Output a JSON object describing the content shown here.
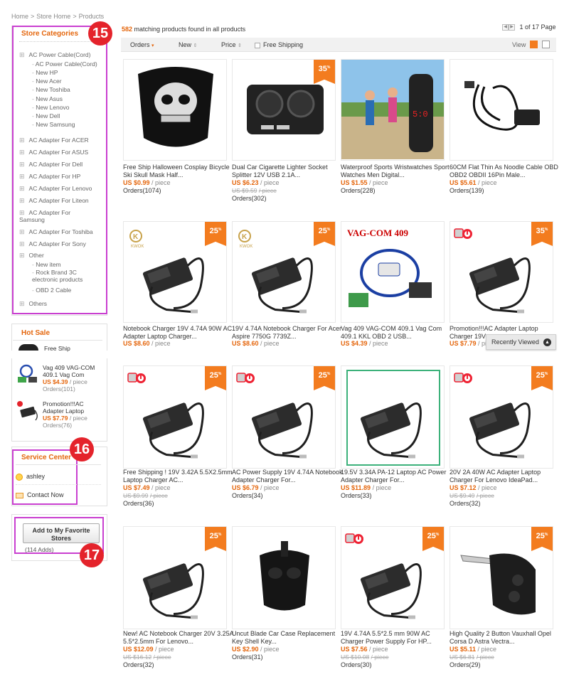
{
  "breadcrumb": [
    "Home",
    "Store Home",
    "Products"
  ],
  "sidebar": {
    "categories_title": "Store Categories",
    "categories": [
      {
        "label": "AC Power Cable(Cord)",
        "level": "top"
      },
      {
        "label": "AC Power Cable(Cord)",
        "level": "sub"
      },
      {
        "label": "New HP",
        "level": "sub"
      },
      {
        "label": "New Acer",
        "level": "sub"
      },
      {
        "label": "New Toshiba",
        "level": "sub"
      },
      {
        "label": "New Asus",
        "level": "sub"
      },
      {
        "label": "New Lenovo",
        "level": "sub"
      },
      {
        "label": "New Dell",
        "level": "sub"
      },
      {
        "label": "New Samsung",
        "level": "sub"
      },
      {
        "label": "AC Adapter For ACER",
        "level": "top"
      },
      {
        "label": "AC Adapter For ASUS",
        "level": "top"
      },
      {
        "label": "AC Adapter For Dell",
        "level": "top"
      },
      {
        "label": "AC Adapter For HP",
        "level": "top"
      },
      {
        "label": "AC Adapter For Lenovo",
        "level": "top"
      },
      {
        "label": "AC Adapter For Liteon",
        "level": "top"
      },
      {
        "label": "AC Adapter For Samsung",
        "level": "top"
      },
      {
        "label": "AC Adapter For Toshiba",
        "level": "top"
      },
      {
        "label": "AC Adapter For Sony",
        "level": "top"
      },
      {
        "label": "Other",
        "level": "top"
      },
      {
        "label": "New item",
        "level": "sub"
      },
      {
        "label": "Rock Brand 3C electronic products",
        "level": "sub"
      },
      {
        "label": "OBD 2 Cable",
        "level": "sub"
      },
      {
        "label": "Others",
        "level": "top"
      }
    ],
    "hot_sale_title": "Hot Sale",
    "hot_sale": [
      {
        "title": "Free Ship",
        "price": "",
        "old": "",
        "orders": ""
      },
      {
        "title": "Vag 409 VAG-COM 409.1 Vag Com",
        "price": "US $4.39",
        "orders": "Orders(101)"
      },
      {
        "title": "Promotion!!!AC Adapter Laptop",
        "price": "US $7.79",
        "orders": "Orders(76)"
      }
    ],
    "piece": "/ piece",
    "service_title": "Service Center",
    "service_user": "ashley",
    "contact": "Contact Now",
    "favorite_button": "Add to My Favorite Stores",
    "favorite_count": "(114 Adds)"
  },
  "badges": [
    "15",
    "16",
    "17"
  ],
  "results": {
    "count": "582",
    "text": "matching products found in all products"
  },
  "pager": {
    "text": "1 of 17 Page"
  },
  "sortbar": {
    "orders": "Orders",
    "new": "New",
    "price": "Price",
    "free_shipping": "Free Shipping",
    "view": "View"
  },
  "recently_viewed": "Recently Viewed",
  "products": [
    {
      "title": "Free Ship Halloween Cosplay Bicycle Ski Skull Mask Half...",
      "price": "US $0.99",
      "old": "",
      "orders": "Orders(1074)",
      "discount": "",
      "img": "mask"
    },
    {
      "title": "Dual Car Cigarette Lighter Socket Splitter 12V USB 2.1A...",
      "price": "US $6.23",
      "old": "US $9.59",
      "orders": "Orders(302)",
      "discount": "35",
      "img": "socket"
    },
    {
      "title": "Waterproof Sports Wristwatches Sport Watches Men Digital...",
      "price": "US $1.55",
      "old": "",
      "orders": "Orders(228)",
      "discount": "",
      "img": "watch"
    },
    {
      "title": "60CM Flat Thin As Noodle Cable OBD OBD2 OBDII 16Pin Male...",
      "price": "US $5.61",
      "old": "",
      "orders": "Orders(139)",
      "discount": "",
      "img": "obd"
    },
    {
      "title": "Notebook Charger 19V 4.74A 90W AC Adapter Laptop Charger...",
      "price": "US $8.60",
      "old": "",
      "orders": "",
      "discount": "25",
      "img": "charger-kwok"
    },
    {
      "title": "19V 4.74A Notebook Charger For Acer Aspire 7750G 7739Z...",
      "price": "US $8.60",
      "old": "",
      "orders": "",
      "discount": "25",
      "img": "charger-kwok"
    },
    {
      "title": "Vag 409 VAG-COM 409.1 Vag Com 409.1 KKL OBD 2 USB...",
      "price": "US $4.39",
      "old": "",
      "orders": "",
      "discount": "",
      "img": "vag"
    },
    {
      "title": "Promotion!!!AC Adapter Laptop Charger 19V...",
      "price": "US $7.79",
      "old": "",
      "orders": "",
      "discount": "35",
      "img": "charger-red"
    },
    {
      "title": "Free Shipping ! 19V 3.42A 5.5X2.5mm Laptop Charger AC...",
      "price": "US $7.49",
      "old": "US $9.99",
      "orders": "Orders(36)",
      "discount": "25",
      "img": "charger-red"
    },
    {
      "title": "AC Power Supply 19V 4.74A Notebook Adapter Charger For...",
      "price": "US $6.79",
      "old": "",
      "orders": "Orders(34)",
      "discount": "25",
      "img": "charger-red"
    },
    {
      "title": "19.5V 3.34A PA-12 Laptop AC Power Adapter Charger For...",
      "price": "US $11.89",
      "old": "",
      "orders": "Orders(33)",
      "discount": "",
      "img": "charger-green"
    },
    {
      "title": "20V 2A 40W AC Adapter Laptop Charger For Lenovo IdeaPad...",
      "price": "US $7.12",
      "old": "US $9.49",
      "orders": "Orders(32)",
      "discount": "25",
      "img": "charger-red"
    },
    {
      "title": "New! AC Notebook Charger 20V 3.25A 5.5*2.5mm For Lenovo...",
      "price": "US $12.09",
      "old": "US $16.12",
      "orders": "Orders(32)",
      "discount": "25",
      "img": "charger-plain"
    },
    {
      "title": "Uncut Blade Car Case Replacement Key Shell Key...",
      "price": "US $2.90",
      "old": "",
      "orders": "Orders(31)",
      "discount": "",
      "img": "key"
    },
    {
      "title": "19V 4.74A 5.5*2.5 mm 90W AC Charger Power Supply For HP...",
      "price": "US $7.56",
      "old": "US $10.08",
      "orders": "Orders(30)",
      "discount": "25",
      "img": "charger-red"
    },
    {
      "title": "High Quality 2 Button Vauxhall Opel Corsa D Astra Vectra...",
      "price": "US $5.11",
      "old": "US $6.81",
      "orders": "Orders(29)",
      "discount": "25",
      "img": "flipkey"
    }
  ],
  "colors": {
    "accent": "#e4650b",
    "discount": "#f37c1f",
    "badge": "#e4232b",
    "highlight": "#c93fd0"
  }
}
